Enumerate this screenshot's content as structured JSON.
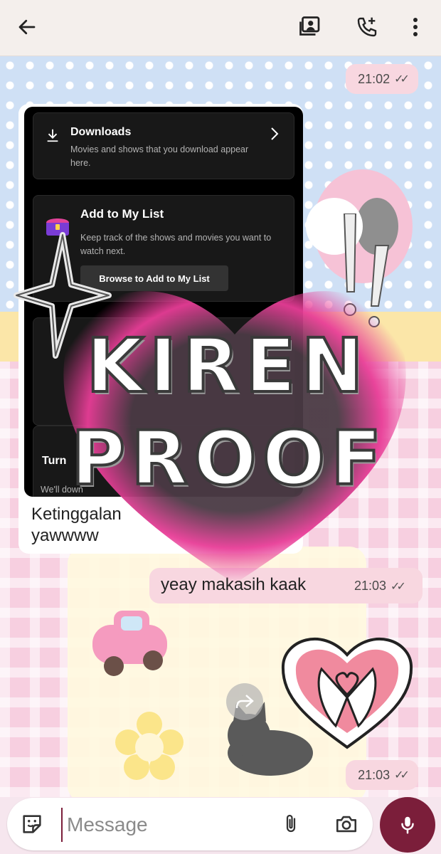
{
  "header": {
    "contact_name": "",
    "icons": {
      "back": "arrow-left-icon",
      "video": "video-call-icon",
      "call": "add-call-icon",
      "menu": "more-vertical-icon"
    }
  },
  "messages": [
    {
      "id": "m1",
      "direction": "out",
      "time": "21:02",
      "status": "read"
    },
    {
      "id": "m2",
      "direction": "in",
      "type": "image+caption",
      "caption": "Ketinggalan\nyawwww"
    },
    {
      "id": "m3",
      "direction": "out",
      "text": "yeay makasih kaak",
      "time": "21:03",
      "status": "read"
    },
    {
      "id": "m4",
      "direction": "out",
      "type": "sticker",
      "time": "21:03",
      "status": "read"
    }
  ],
  "embedded_screenshot": {
    "downloads": {
      "title": "Downloads",
      "desc": "Movies and shows that you download appear here."
    },
    "my_list": {
      "title": "Add to My List",
      "desc": "Keep track of the shows and movies you want to watch next.",
      "button": "Browse to Add to My List"
    },
    "bottom_card": {
      "title": "Turn",
      "desc": "We'll down"
    }
  },
  "sticker": {
    "line1": "KIREN",
    "line2": "PROOF",
    "heart_color": "#e83d97",
    "heart_center": "#4a3a44"
  },
  "composer": {
    "placeholder": "Message",
    "icons": {
      "emoji": "sticker-icon",
      "attach": "paperclip-icon",
      "camera": "camera-icon",
      "mic": "microphone-icon"
    }
  },
  "colors": {
    "accent": "#7b1e3a",
    "outgoing_bubble": "#f8d7e0"
  }
}
